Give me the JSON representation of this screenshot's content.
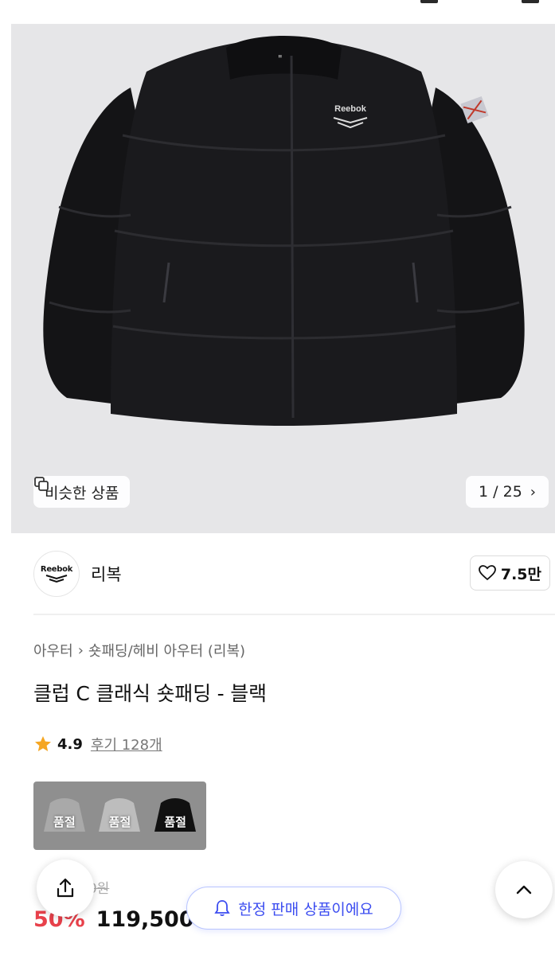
{
  "gallery": {
    "similar_label": "비슷한 상품",
    "counter": "1 / 25",
    "jacket_logo_text": "Reebok"
  },
  "brand": {
    "logo_text": "Reebok",
    "name": "리복",
    "likes": "7.5만"
  },
  "breadcrumb": [
    "아우터",
    "숏패딩/헤비 아우터 (리복)"
  ],
  "product": {
    "title": "클럽 C 클래식 숏패딩 - 블랙",
    "rating": "4.9",
    "reviews": "후기 128개"
  },
  "variants": [
    {
      "color": "gray",
      "status": "품절"
    },
    {
      "color": "lightgray",
      "status": "품절"
    },
    {
      "color": "black",
      "status": "품절"
    }
  ],
  "pricing": {
    "original": "00원",
    "discount": "50%",
    "price": "119,500"
  },
  "floating": {
    "limited_sale": "한정 판매 상품이에요"
  },
  "colors": {
    "accent_red": "#e8414b",
    "accent_blue": "#3b4cf0",
    "star": "#f5a623"
  }
}
